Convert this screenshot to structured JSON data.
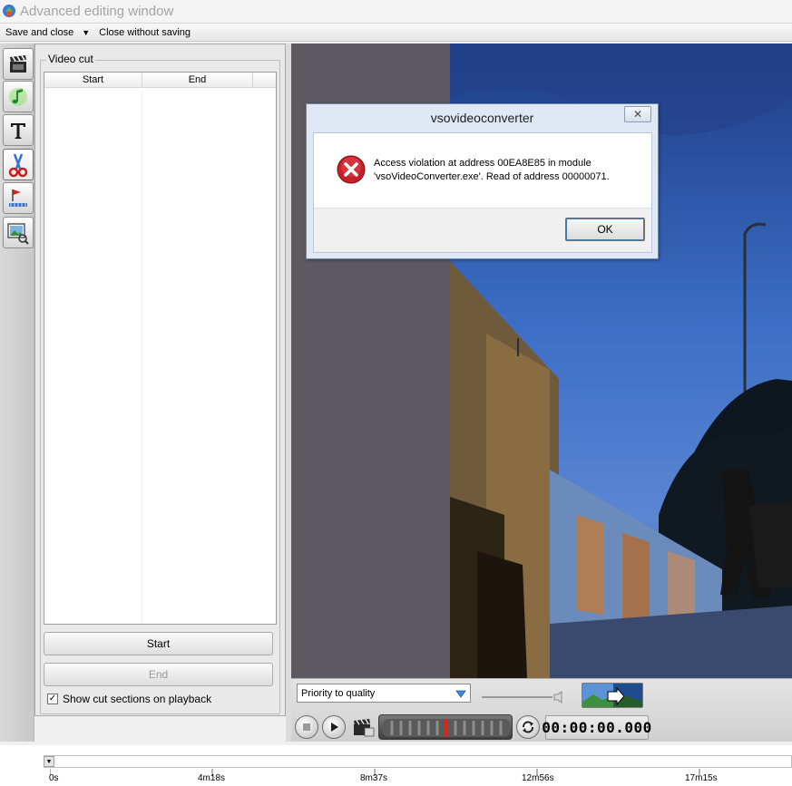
{
  "window": {
    "title": "Advanced editing window",
    "app_icon": "vso-app-icon"
  },
  "menu": {
    "save_and_close": "Save and close",
    "close_without_saving": "Close without saving"
  },
  "toolstrip": {
    "tools": [
      {
        "name": "video-effects-tool",
        "icon": "film-clapper-icon"
      },
      {
        "name": "audio-tool",
        "icon": "music-note-icon"
      },
      {
        "name": "text-tool",
        "icon": "text-t-icon"
      },
      {
        "name": "video-cut-tool",
        "icon": "scissors-icon",
        "active": true
      },
      {
        "name": "chapters-tool",
        "icon": "flag-icon"
      },
      {
        "name": "crop-zoom-tool",
        "icon": "image-zoom-icon"
      }
    ]
  },
  "video_cut": {
    "legend": "Video cut",
    "columns": [
      "Start",
      "End"
    ],
    "rows": [],
    "start_button": "Start",
    "end_button": "End",
    "show_cut_sections_label": "Show cut sections on playback",
    "show_cut_sections_checked": true
  },
  "playback": {
    "quality_selected": "Priority to quality",
    "timecode": "00:00:00.000"
  },
  "timeline": {
    "labels": [
      "0s",
      "4m18s",
      "8m37s",
      "12m56s",
      "17m15s"
    ]
  },
  "dialog": {
    "title": "vsovideoconverter",
    "close_glyph": "✕",
    "message_line1": "Access violation at address 00EA8E85 in module",
    "message_line2": "'vsoVideoConverter.exe'. Read of address 00000071.",
    "ok_label": "OK"
  },
  "colors": {
    "viewport_bg": "#5c5a60",
    "dialog_frame": "#dfe9f5",
    "error_red": "#c8202a",
    "playhead_red": "#d8281e"
  }
}
